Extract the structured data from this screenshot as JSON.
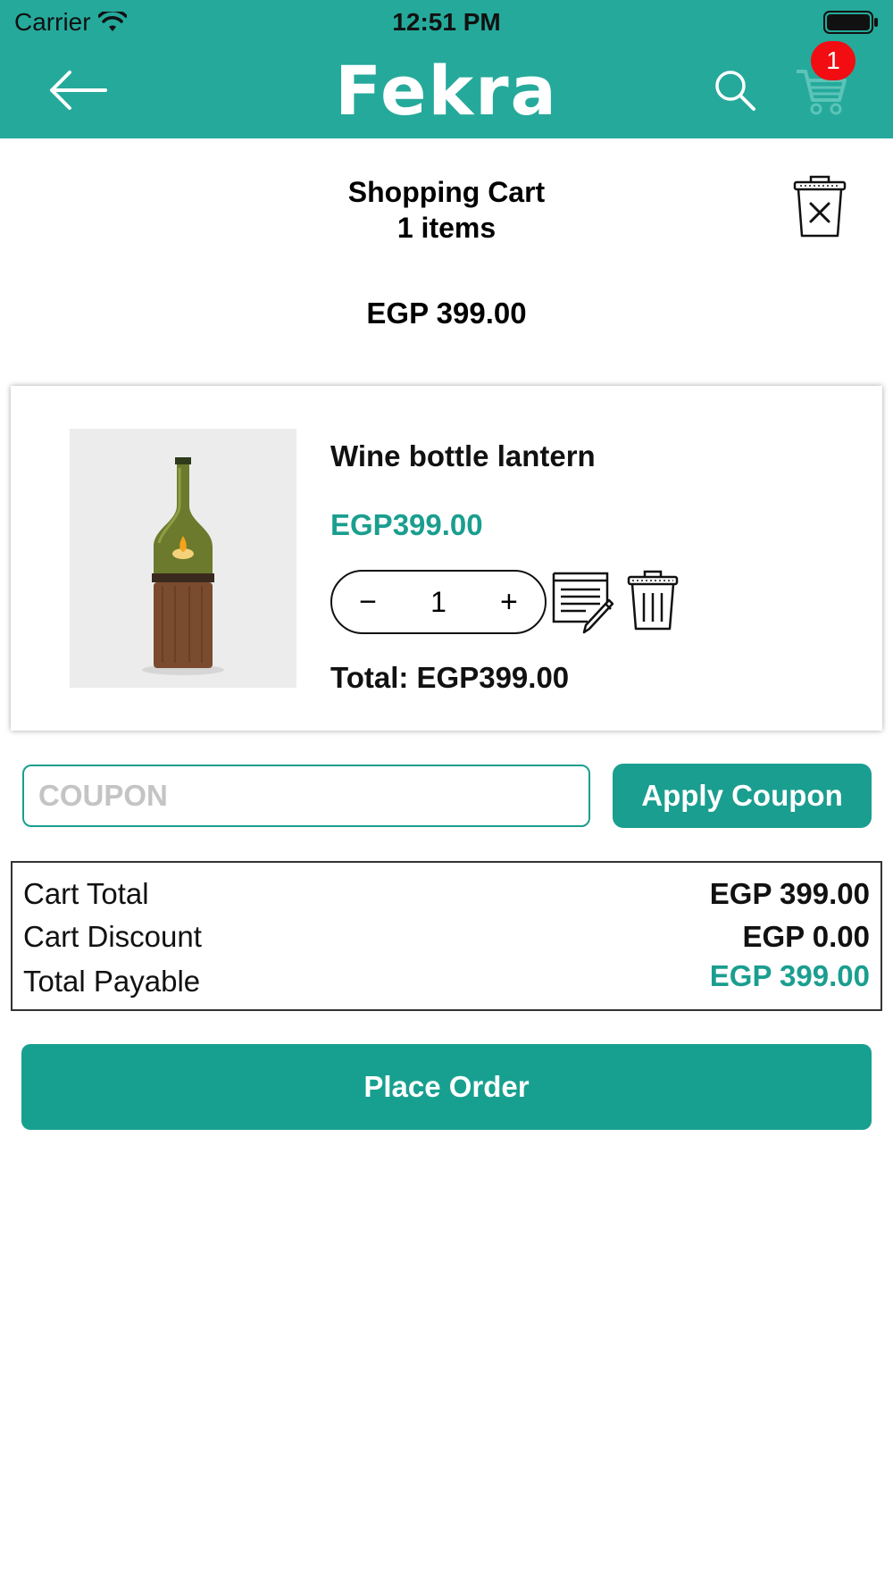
{
  "status_bar": {
    "carrier": "Carrier",
    "time": "12:51 PM"
  },
  "header": {
    "logo_text": "Fekra",
    "cart_badge_count": "1",
    "icons": [
      "back-arrow-icon",
      "search-icon",
      "cart-icon"
    ],
    "colors": {
      "bar": "#25a99b",
      "badge": "#f20d12"
    }
  },
  "cart": {
    "title": "Shopping Cart",
    "items_count_label": "1 items",
    "amount": "EGP 399.00"
  },
  "item": {
    "name": "Wine bottle lantern",
    "price": "EGP399.00",
    "quantity": "1",
    "decrement_label": "−",
    "increment_label": "+",
    "total": "Total: EGP399.00"
  },
  "coupon": {
    "placeholder": "COUPON",
    "value": "",
    "apply_label": "Apply Coupon"
  },
  "summary": {
    "rows": [
      {
        "label": "Cart Total",
        "value": "EGP 399.00"
      },
      {
        "label": "Cart Discount",
        "value": "EGP 0.00"
      },
      {
        "label": "Total Payable",
        "value": "EGP 399.00"
      }
    ]
  },
  "actions": {
    "place_order_label": "Place Order"
  },
  "colors": {
    "accent": "#1a9e8f"
  }
}
